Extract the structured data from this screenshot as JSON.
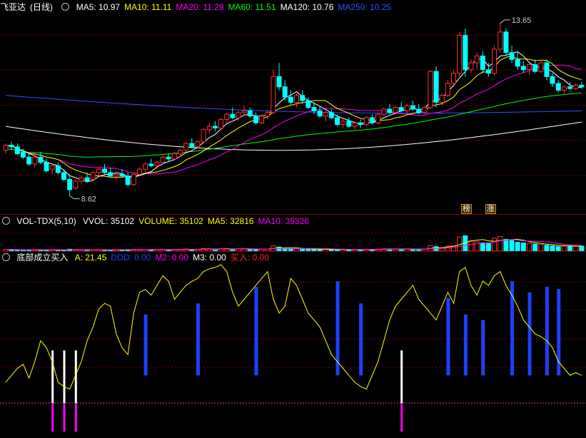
{
  "stock": {
    "name": "飞亚达",
    "period": "(日线)"
  },
  "price_panel": {
    "ma_labels": [
      {
        "text": "MA5: 10.97",
        "color": "#ffffff"
      },
      {
        "text": "MA10: 11.11",
        "color": "#ffff00"
      },
      {
        "text": "MA20: 11.28",
        "color": "#ff00ff"
      },
      {
        "text": "MA60: 11.51",
        "color": "#00ff00"
      },
      {
        "text": "MA120: 10.76",
        "color": "#ffffff"
      },
      {
        "text": "MA250: 10.25",
        "color": "#3050ff"
      }
    ],
    "high_label": "13.65",
    "low_label": "8.62",
    "tags": [
      "榜",
      "涨"
    ]
  },
  "vol_panel": {
    "indicator": "VOL-TDX(5,10)",
    "labels": [
      {
        "text": "VVOL: 35102",
        "color": "#ffffff"
      },
      {
        "text": "VOLUME: 35102",
        "color": "#ffff00"
      },
      {
        "text": "MA5: 32816",
        "color": "#ffff00"
      },
      {
        "text": "MA10: 39326",
        "color": "#ff00ff"
      }
    ]
  },
  "ind_panel": {
    "indicator": "底部成立买入",
    "labels": [
      {
        "text": "A: 21.45",
        "color": "#ffff00"
      },
      {
        "text": "DDD: 0.00",
        "color": "#1e40ff"
      },
      {
        "text": "M2: 0.00",
        "color": "#ff00ff"
      },
      {
        "text": "M3: 0.00",
        "color": "#ffffff"
      },
      {
        "text": "买入: 0.00",
        "color": "#ff2020"
      }
    ]
  },
  "colors": {
    "up": "#ff3030",
    "down": "#00ffff",
    "grid": "#7a0000"
  },
  "chart_data": [
    {
      "type": "candlestick",
      "title": "飞亚达(日线)",
      "ylim": [
        8.3,
        14.0
      ],
      "candles": [
        [
          9.95,
          10.15,
          9.85,
          10.1
        ],
        [
          10.1,
          10.2,
          9.95,
          10.05
        ],
        [
          10.05,
          10.15,
          9.8,
          9.85
        ],
        [
          9.9,
          10.0,
          9.7,
          9.75
        ],
        [
          9.75,
          9.85,
          9.5,
          9.55
        ],
        [
          9.55,
          9.8,
          9.45,
          9.75
        ],
        [
          9.75,
          9.9,
          9.55,
          9.6
        ],
        [
          9.6,
          9.7,
          9.3,
          9.35
        ],
        [
          9.4,
          9.55,
          9.25,
          9.5
        ],
        [
          9.5,
          9.6,
          9.25,
          9.3
        ],
        [
          9.3,
          9.4,
          9.05,
          9.1
        ],
        [
          9.1,
          9.25,
          8.62,
          8.8
        ],
        [
          8.85,
          9.1,
          8.8,
          9.05
        ],
        [
          9.05,
          9.2,
          8.95,
          9.15
        ],
        [
          9.15,
          9.3,
          9.0,
          9.05
        ],
        [
          9.1,
          9.35,
          9.05,
          9.3
        ],
        [
          9.3,
          9.45,
          9.2,
          9.4
        ],
        [
          9.4,
          9.55,
          9.25,
          9.3
        ],
        [
          9.3,
          9.45,
          9.15,
          9.2
        ],
        [
          9.2,
          9.35,
          9.1,
          9.25
        ],
        [
          9.25,
          9.4,
          9.15,
          9.2
        ],
        [
          9.2,
          9.3,
          8.9,
          8.95
        ],
        [
          8.95,
          9.3,
          8.9,
          9.25
        ],
        [
          9.25,
          9.45,
          9.2,
          9.4
        ],
        [
          9.4,
          9.6,
          9.3,
          9.55
        ],
        [
          9.55,
          9.7,
          9.45,
          9.5
        ],
        [
          9.5,
          9.65,
          9.4,
          9.6
        ],
        [
          9.6,
          9.8,
          9.55,
          9.75
        ],
        [
          9.75,
          9.85,
          9.6,
          9.7
        ],
        [
          9.7,
          9.9,
          9.65,
          9.85
        ],
        [
          9.85,
          10.0,
          9.75,
          9.95
        ],
        [
          9.95,
          10.2,
          9.9,
          10.15
        ],
        [
          10.15,
          10.3,
          10.0,
          10.05
        ],
        [
          10.05,
          10.25,
          10.0,
          10.2
        ],
        [
          10.2,
          10.6,
          10.15,
          10.55
        ],
        [
          10.55,
          10.75,
          10.45,
          10.65
        ],
        [
          10.65,
          10.8,
          10.5,
          10.6
        ],
        [
          10.6,
          10.9,
          10.55,
          10.85
        ],
        [
          10.85,
          11.05,
          10.75,
          11.0
        ],
        [
          11.0,
          11.2,
          10.85,
          10.9
        ],
        [
          10.9,
          11.1,
          10.8,
          11.05
        ],
        [
          11.05,
          11.25,
          10.95,
          11.1
        ],
        [
          11.1,
          11.2,
          10.9,
          10.95
        ],
        [
          10.95,
          11.05,
          10.7,
          10.75
        ],
        [
          10.75,
          11.0,
          10.7,
          10.95
        ],
        [
          10.95,
          11.1,
          10.85,
          11.05
        ],
        [
          11.05,
          12.3,
          11.0,
          12.1
        ],
        [
          12.1,
          12.5,
          11.7,
          11.8
        ],
        [
          11.8,
          12.0,
          11.4,
          11.5
        ],
        [
          11.5,
          11.7,
          11.25,
          11.35
        ],
        [
          11.35,
          11.6,
          11.2,
          11.55
        ],
        [
          11.55,
          11.7,
          11.3,
          11.4
        ],
        [
          11.4,
          11.5,
          11.15,
          11.2
        ],
        [
          11.2,
          11.35,
          11.0,
          11.1
        ],
        [
          11.1,
          11.25,
          10.9,
          10.95
        ],
        [
          10.95,
          11.1,
          10.8,
          11.05
        ],
        [
          11.05,
          11.15,
          10.85,
          10.9
        ],
        [
          10.9,
          11.0,
          10.65,
          10.7
        ],
        [
          10.7,
          10.85,
          10.6,
          10.8
        ],
        [
          10.8,
          10.9,
          10.6,
          10.65
        ],
        [
          10.65,
          10.8,
          10.55,
          10.75
        ],
        [
          10.75,
          10.85,
          10.6,
          10.7
        ],
        [
          10.7,
          10.95,
          10.65,
          10.9
        ],
        [
          10.9,
          11.0,
          10.7,
          10.75
        ],
        [
          10.75,
          11.05,
          10.7,
          11.0
        ],
        [
          11.0,
          11.2,
          10.95,
          11.15
        ],
        [
          11.15,
          11.3,
          11.0,
          11.05
        ],
        [
          11.05,
          11.25,
          11.0,
          11.2
        ],
        [
          11.2,
          11.35,
          11.05,
          11.1
        ],
        [
          11.1,
          11.3,
          11.0,
          11.25
        ],
        [
          11.25,
          11.4,
          11.1,
          11.15
        ],
        [
          11.15,
          11.3,
          11.0,
          11.05
        ],
        [
          11.05,
          11.25,
          11.0,
          11.2
        ],
        [
          11.2,
          12.3,
          11.15,
          12.25
        ],
        [
          12.25,
          12.4,
          11.2,
          11.35
        ],
        [
          11.35,
          11.6,
          11.25,
          11.55
        ],
        [
          11.55,
          12.0,
          11.5,
          11.9
        ],
        [
          11.9,
          12.3,
          11.8,
          12.2
        ],
        [
          12.2,
          13.4,
          12.1,
          13.3
        ],
        [
          13.3,
          13.5,
          12.1,
          12.3
        ],
        [
          12.3,
          12.6,
          12.2,
          12.5
        ],
        [
          12.5,
          12.8,
          12.3,
          12.7
        ],
        [
          12.7,
          12.85,
          12.2,
          12.3
        ],
        [
          12.3,
          12.5,
          12.1,
          12.2
        ],
        [
          12.2,
          13.0,
          12.15,
          12.9
        ],
        [
          12.9,
          13.65,
          12.8,
          13.4
        ],
        [
          13.4,
          13.5,
          12.7,
          12.8
        ],
        [
          12.8,
          13.0,
          12.5,
          12.6
        ],
        [
          12.6,
          12.8,
          12.3,
          12.4
        ],
        [
          12.4,
          12.55,
          12.2,
          12.3
        ],
        [
          12.3,
          12.5,
          12.15,
          12.45
        ],
        [
          12.45,
          12.6,
          12.2,
          12.25
        ],
        [
          12.25,
          12.55,
          12.2,
          12.5
        ],
        [
          12.5,
          12.6,
          12.0,
          12.1
        ],
        [
          12.1,
          12.2,
          11.8,
          11.9
        ],
        [
          11.9,
          12.0,
          11.65,
          11.7
        ],
        [
          11.7,
          11.85,
          11.6,
          11.8
        ],
        [
          11.8,
          11.95,
          11.7,
          11.75
        ],
        [
          11.75,
          11.9,
          11.7,
          11.85
        ],
        [
          11.85,
          11.95,
          11.75,
          11.8
        ]
      ],
      "series": [
        {
          "name": "MA5",
          "color": "#ffffff"
        },
        {
          "name": "MA10",
          "color": "#ffff00"
        },
        {
          "name": "MA20",
          "color": "#ff00ff"
        },
        {
          "name": "MA60",
          "color": "#00ff00"
        },
        {
          "name": "MA120",
          "color": "#ffffff"
        },
        {
          "name": "MA250",
          "color": "#3050ff"
        }
      ]
    },
    {
      "type": "bar",
      "title": "VOL-TDX(5,10)",
      "ylim": [
        0,
        40000
      ],
      "values": [
        3000,
        2600,
        2200,
        2000,
        2300,
        2000,
        1900,
        2400,
        2100,
        1800,
        2000,
        3200,
        2600,
        2200,
        2000,
        2300,
        2400,
        2100,
        1900,
        2000,
        2200,
        2600,
        3000,
        2700,
        2500,
        2300,
        2600,
        2800,
        2500,
        2900,
        3100,
        3600,
        3000,
        2800,
        4200,
        3800,
        3400,
        3900,
        4200,
        3600,
        3800,
        4000,
        3500,
        3100,
        3300,
        3600,
        9000,
        7000,
        5000,
        4200,
        4000,
        3700,
        3300,
        3100,
        2900,
        3000,
        2800,
        2600,
        2700,
        2500,
        2600,
        2700,
        3200,
        2900,
        3400,
        3800,
        3500,
        3600,
        3400,
        3600,
        3500,
        3200,
        3400,
        9500,
        7500,
        5500,
        8500,
        9000,
        24000,
        26000,
        18000,
        16000,
        14000,
        13000,
        22000,
        25000,
        20000,
        18000,
        15000,
        14000,
        13000,
        12000,
        11000,
        10000,
        9000,
        8000,
        8500,
        9000,
        8000,
        8500
      ]
    },
    {
      "type": "line",
      "title": "底部成立买入",
      "ylim": [
        0,
        100
      ],
      "series": [
        {
          "name": "A",
          "values": [
            15,
            20,
            25,
            28,
            18,
            30,
            45,
            40,
            30,
            15,
            12,
            10,
            20,
            30,
            45,
            55,
            68,
            72,
            70,
            50,
            40,
            35,
            65,
            80,
            82,
            78,
            85,
            92,
            88,
            75,
            80,
            85,
            88,
            90,
            95,
            97,
            98,
            100,
            95,
            80,
            70,
            75,
            80,
            85,
            90,
            95,
            75,
            65,
            70,
            90,
            85,
            75,
            65,
            60,
            55,
            45,
            35,
            30,
            25,
            20,
            15,
            12,
            10,
            20,
            30,
            45,
            60,
            70,
            75,
            80,
            85,
            75,
            70,
            65,
            60,
            70,
            80,
            72,
            95,
            98,
            85,
            78,
            88,
            85,
            92,
            95,
            85,
            78,
            70,
            60,
            55,
            50,
            48,
            45,
            40,
            30,
            25,
            20,
            22,
            20
          ]
        }
      ],
      "bars_ddd": [
        {
          "index": 24,
          "value": 55
        },
        {
          "index": 33,
          "value": 65
        },
        {
          "index": 43,
          "value": 80
        },
        {
          "index": 57,
          "value": 85
        },
        {
          "index": 61,
          "value": 65
        },
        {
          "index": 76,
          "value": 70
        },
        {
          "index": 79,
          "value": 55
        },
        {
          "index": 82,
          "value": 50
        },
        {
          "index": 87,
          "value": 85
        },
        {
          "index": 90,
          "value": 75
        },
        {
          "index": 93,
          "value": 80
        },
        {
          "index": 95,
          "value": 78
        }
      ],
      "bars_m3": [
        {
          "index": 8,
          "value": 0
        },
        {
          "index": 10,
          "value": 0
        },
        {
          "index": 12,
          "value": 0
        },
        {
          "index": 68,
          "value": 0
        }
      ],
      "bars_m2": [
        {
          "index": 8,
          "value": 0
        },
        {
          "index": 10,
          "value": 0
        },
        {
          "index": 12,
          "value": 0
        },
        {
          "index": 68,
          "value": 0
        }
      ]
    }
  ]
}
